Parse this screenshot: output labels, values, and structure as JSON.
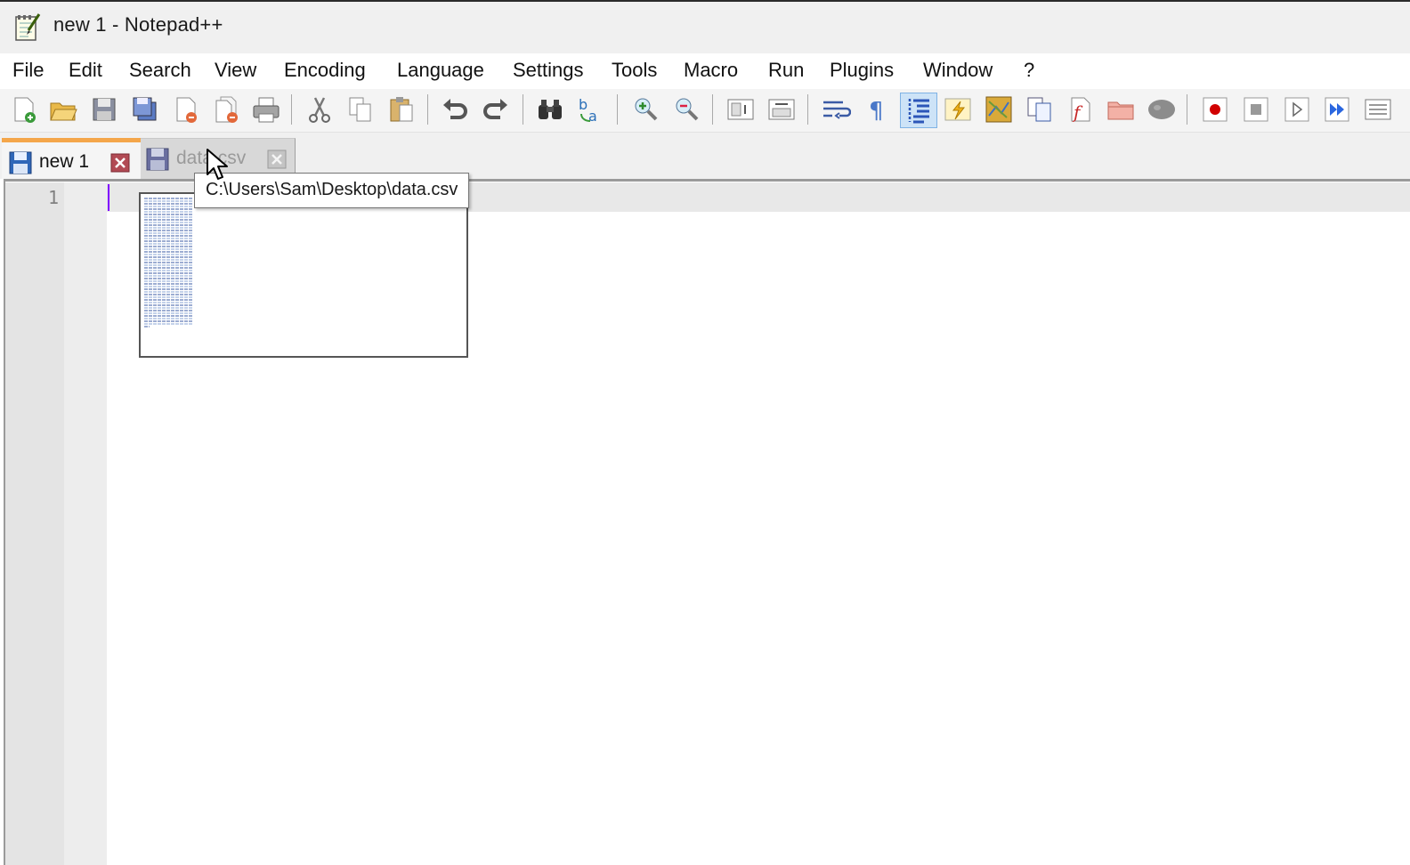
{
  "window": {
    "title": "new 1 - Notepad++"
  },
  "menu": {
    "items": [
      "File",
      "Edit",
      "Search",
      "View",
      "Encoding",
      "Language",
      "Settings",
      "Tools",
      "Macro",
      "Run",
      "Plugins",
      "Window",
      "?"
    ]
  },
  "toolbar": {
    "buttons": [
      "new-file-icon",
      "open-file-icon",
      "save-icon",
      "save-all-icon",
      "close-icon",
      "close-all-icon",
      "print-icon",
      "cut-icon",
      "copy-icon",
      "paste-icon",
      "undo-icon",
      "redo-icon",
      "find-icon",
      "replace-icon",
      "zoom-in-icon",
      "zoom-out-icon",
      "sync-vertical-icon",
      "sync-horizontal-icon",
      "word-wrap-icon",
      "show-all-characters-icon",
      "indent-guide-icon",
      "udl-icon",
      "document-map-icon",
      "document-list-icon",
      "function-list-icon",
      "folder-as-workspace-icon",
      "monitoring-icon",
      "record-macro-icon",
      "stop-recording-icon",
      "playback-macro-icon",
      "run-macro-multiple-icon",
      "save-macro-icon"
    ],
    "active": "indent-guide-icon"
  },
  "tabs": [
    {
      "label": "new 1",
      "active": true,
      "icon": "save-icon",
      "close": "close-tab-icon"
    },
    {
      "label": "data.csv",
      "active": false,
      "icon": "save-icon",
      "close": "close-tab-icon"
    }
  ],
  "tooltip": {
    "text": "C:\\Users\\Sam\\Desktop\\data.csv"
  },
  "editor": {
    "line_numbers": [
      "1"
    ],
    "content": ""
  },
  "colors": {
    "active_tab_accent": "#f4a64a",
    "caret": "#8000ff",
    "current_line": "#e8e8e8"
  }
}
